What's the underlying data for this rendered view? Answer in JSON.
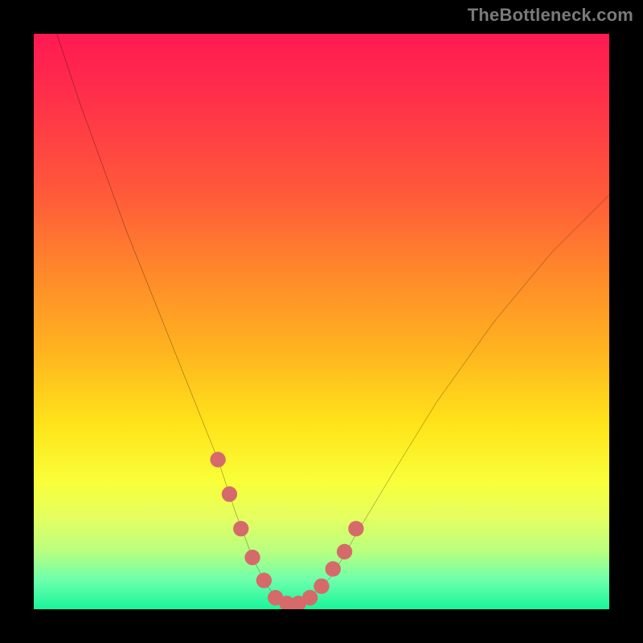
{
  "watermark": "TheBottleneck.com",
  "chart_data": {
    "type": "line",
    "title": "",
    "xlabel": "",
    "ylabel": "",
    "xlim": [
      0,
      100
    ],
    "ylim": [
      0,
      100
    ],
    "background_gradient_stops": [
      {
        "pos": 0,
        "color": "#ff1a52"
      },
      {
        "pos": 10,
        "color": "#ff2d4a"
      },
      {
        "pos": 28,
        "color": "#ff5a3a"
      },
      {
        "pos": 42,
        "color": "#ff8a2a"
      },
      {
        "pos": 55,
        "color": "#ffb31f"
      },
      {
        "pos": 68,
        "color": "#ffe41a"
      },
      {
        "pos": 78,
        "color": "#f9ff3a"
      },
      {
        "pos": 84,
        "color": "#e5ff60"
      },
      {
        "pos": 90,
        "color": "#b8ff80"
      },
      {
        "pos": 95,
        "color": "#6cffac"
      },
      {
        "pos": 100,
        "color": "#18f59a"
      }
    ],
    "series": [
      {
        "name": "bottleneck-curve",
        "x": [
          4,
          8,
          12,
          16,
          20,
          24,
          28,
          32,
          35,
          38,
          40,
          42,
          44,
          46,
          48,
          52,
          56,
          62,
          70,
          80,
          90,
          100
        ],
        "y": [
          100,
          88,
          77,
          66,
          56,
          46,
          36,
          26,
          17,
          9,
          5,
          2,
          1,
          1,
          2,
          6,
          13,
          23,
          36,
          50,
          62,
          72
        ]
      }
    ],
    "markers": {
      "name": "highlight-dots",
      "color": "#d66a6a",
      "points": [
        {
          "x": 32,
          "y": 26
        },
        {
          "x": 34,
          "y": 20
        },
        {
          "x": 36,
          "y": 14
        },
        {
          "x": 38,
          "y": 9
        },
        {
          "x": 40,
          "y": 5
        },
        {
          "x": 42,
          "y": 2
        },
        {
          "x": 44,
          "y": 1
        },
        {
          "x": 46,
          "y": 1
        },
        {
          "x": 48,
          "y": 2
        },
        {
          "x": 50,
          "y": 4
        },
        {
          "x": 52,
          "y": 7
        },
        {
          "x": 54,
          "y": 10
        },
        {
          "x": 56,
          "y": 14
        }
      ]
    }
  }
}
